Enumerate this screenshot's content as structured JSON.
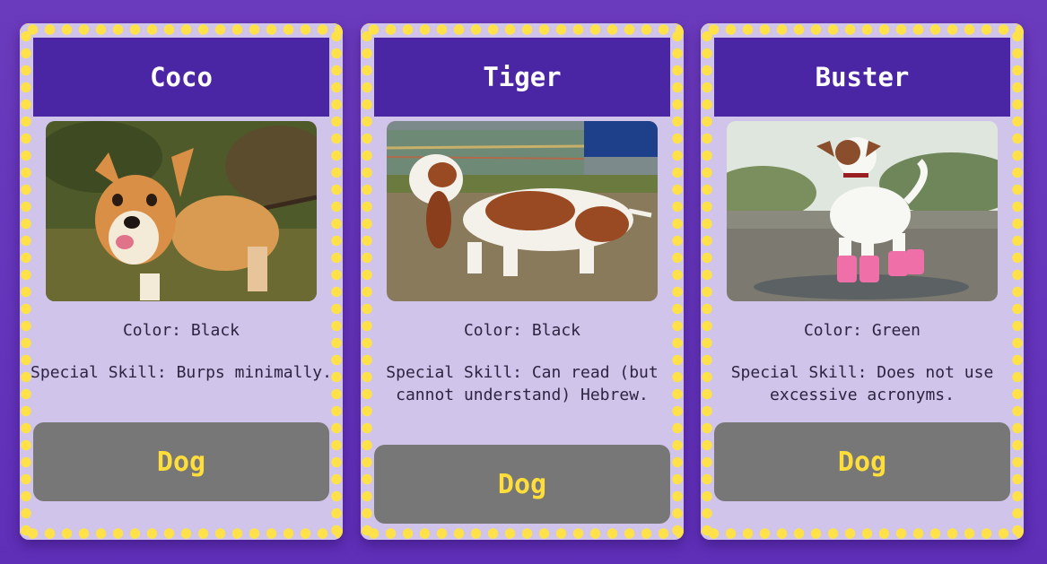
{
  "colors": {
    "page_background": "#6b3bbd",
    "card_background": "#d0c4ea",
    "card_border_dots": "#ffe14a",
    "header_background": "#4b26a4",
    "button_background": "#777777",
    "button_text": "#ffdd3a"
  },
  "cards": [
    {
      "name": "Coco",
      "photo": "corgi-with-stick-photo",
      "color_line": "Color: Black",
      "skill_line": "Special Skill: Burps minimally.",
      "type_label": "Dog"
    },
    {
      "name": "Tiger",
      "photo": "basset-hound-photo",
      "color_line": "Color: Black",
      "skill_line": "Special Skill: Can read (but cannot understand) Hebrew.",
      "type_label": "Dog"
    },
    {
      "name": "Buster",
      "photo": "jack-russell-in-pink-boots-photo",
      "color_line": "Color: Green",
      "skill_line": "Special Skill: Does not use excessive acronyms.",
      "type_label": "Dog"
    }
  ]
}
